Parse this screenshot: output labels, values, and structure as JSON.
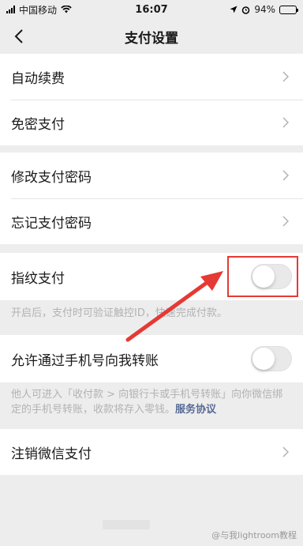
{
  "status_bar": {
    "carrier": "中国移动",
    "time": "16:07",
    "battery": "94%",
    "battery_level": 0.94
  },
  "nav": {
    "title": "支付设置",
    "back_icon": "chevron-left-icon"
  },
  "groups": [
    {
      "items": [
        {
          "label": "自动续费"
        },
        {
          "label": "免密支付"
        }
      ]
    },
    {
      "items": [
        {
          "label": "修改支付密码"
        },
        {
          "label": "忘记支付密码"
        }
      ]
    }
  ],
  "fingerprint": {
    "label": "指纹支付",
    "enabled": false,
    "hint": "开启后，支付时可验证触控ID，快速完成付款。"
  },
  "phone_transfer": {
    "label": "允许通过手机号向我转账",
    "enabled": false,
    "hint": "他人可进入「收付款 > 向银行卡或手机号转账」向你微信绑定的手机号转账，收款将存入零钱。",
    "link": "服务协议"
  },
  "cancel": {
    "label": "注销微信支付"
  },
  "watermark": "@与我lightroom教程",
  "colors": {
    "background": "#ededed",
    "link": "#576b95",
    "annotation_red": "#e53935",
    "toggle_off": "#e9e9ea"
  }
}
